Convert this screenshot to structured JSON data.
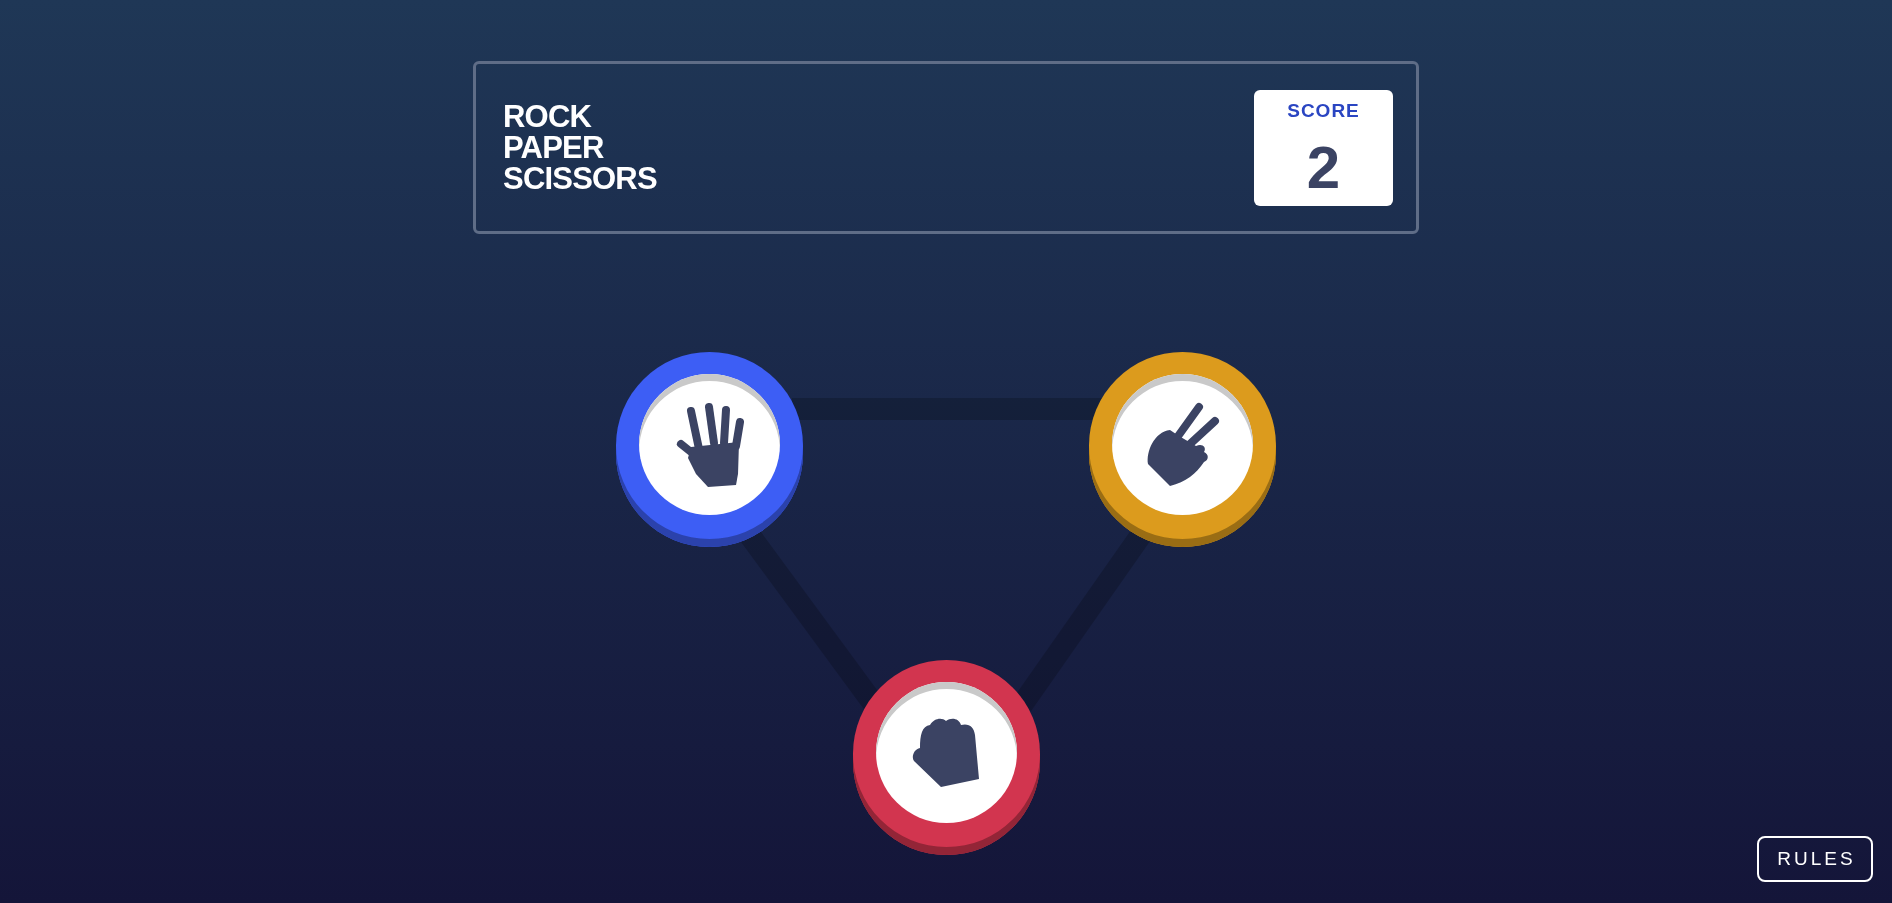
{
  "header": {
    "title": "ROCK PAPER SCISSORS",
    "score": {
      "label": "SCORE",
      "value": "2"
    }
  },
  "choices": [
    {
      "kind": "paper",
      "color": "#3d5ef5"
    },
    {
      "kind": "scissors",
      "color": "#dc9b1d"
    },
    {
      "kind": "rock",
      "color": "#d2354f"
    }
  ],
  "rules_button": {
    "label": "RULES"
  }
}
